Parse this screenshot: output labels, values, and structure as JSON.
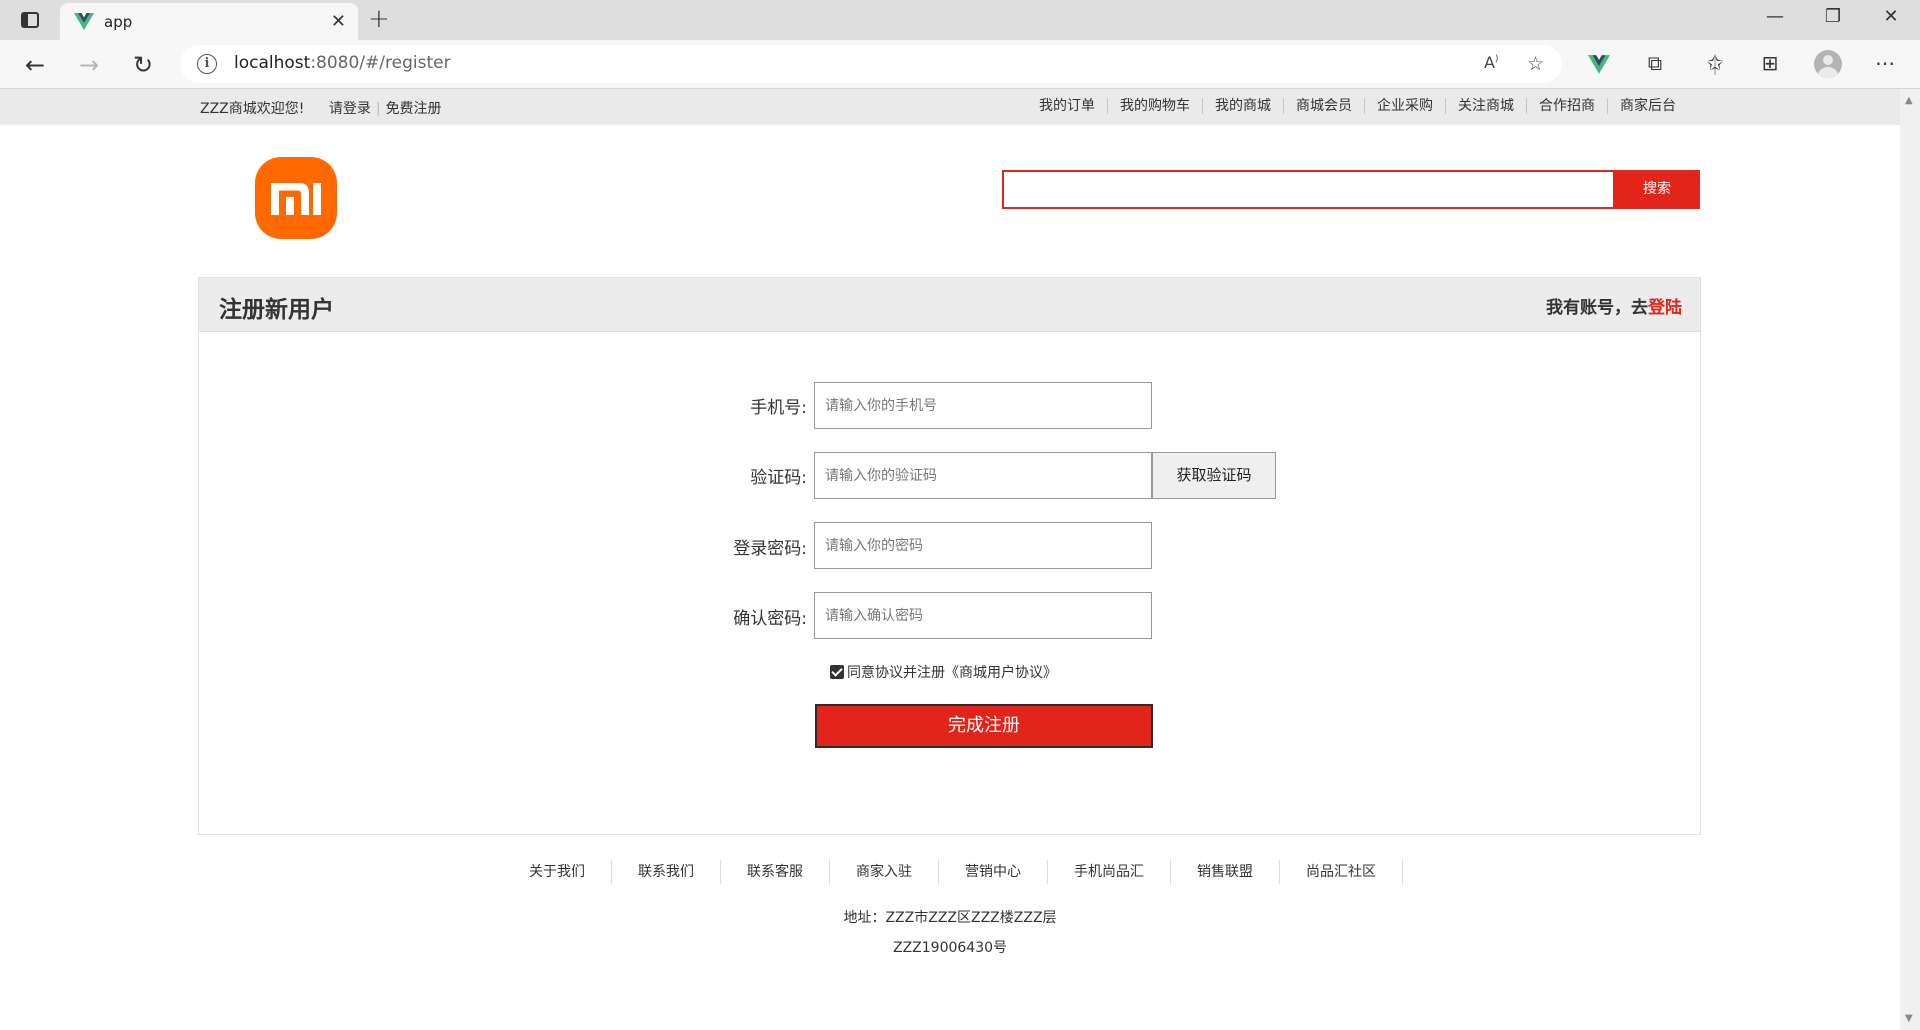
{
  "browser": {
    "tab_title": "app",
    "url_host": "localhost",
    "url_rest": ":8080/#/register"
  },
  "shortcut": {
    "welcome": "ZZZ商城欢迎您!",
    "login": "请登录",
    "register": "免费注册",
    "links": [
      "我的订单",
      "我的购物车",
      "我的商城",
      "商城会员",
      "企业采购",
      "关注商城",
      "合作招商",
      "商家后台"
    ]
  },
  "header": {
    "logo": "mi-logo-icon",
    "search_placeholder": "",
    "search_button": "搜索"
  },
  "register": {
    "title": "注册新用户",
    "have_account": "我有账号，去",
    "login_link": "登陆",
    "phone_label": "手机号:",
    "phone_placeholder": "请输入你的手机号",
    "code_label": "验证码:",
    "code_placeholder": "请输入你的验证码",
    "get_code_button": "获取验证码",
    "password_label": "登录密码:",
    "password_placeholder": "请输入你的密码",
    "confirm_label": "确认密码:",
    "confirm_placeholder": "请输入确认密码",
    "agree_checked": true,
    "agree_text": "同意协议并注册《商城用户协议》",
    "submit_button": "完成注册"
  },
  "footer": {
    "links": [
      "关于我们",
      "联系我们",
      "联系客服",
      "商家入驻",
      "营销中心",
      "手机尚品汇",
      "销售联盟",
      "尚品汇社区"
    ],
    "address": "地址：ZZZ市ZZZ区ZZZ楼ZZZ层",
    "icp": "ZZZ19006430号"
  },
  "colors": {
    "accent_red": "#e1251b",
    "logo_orange": "#ff6900",
    "vue_green": "#41b883"
  }
}
